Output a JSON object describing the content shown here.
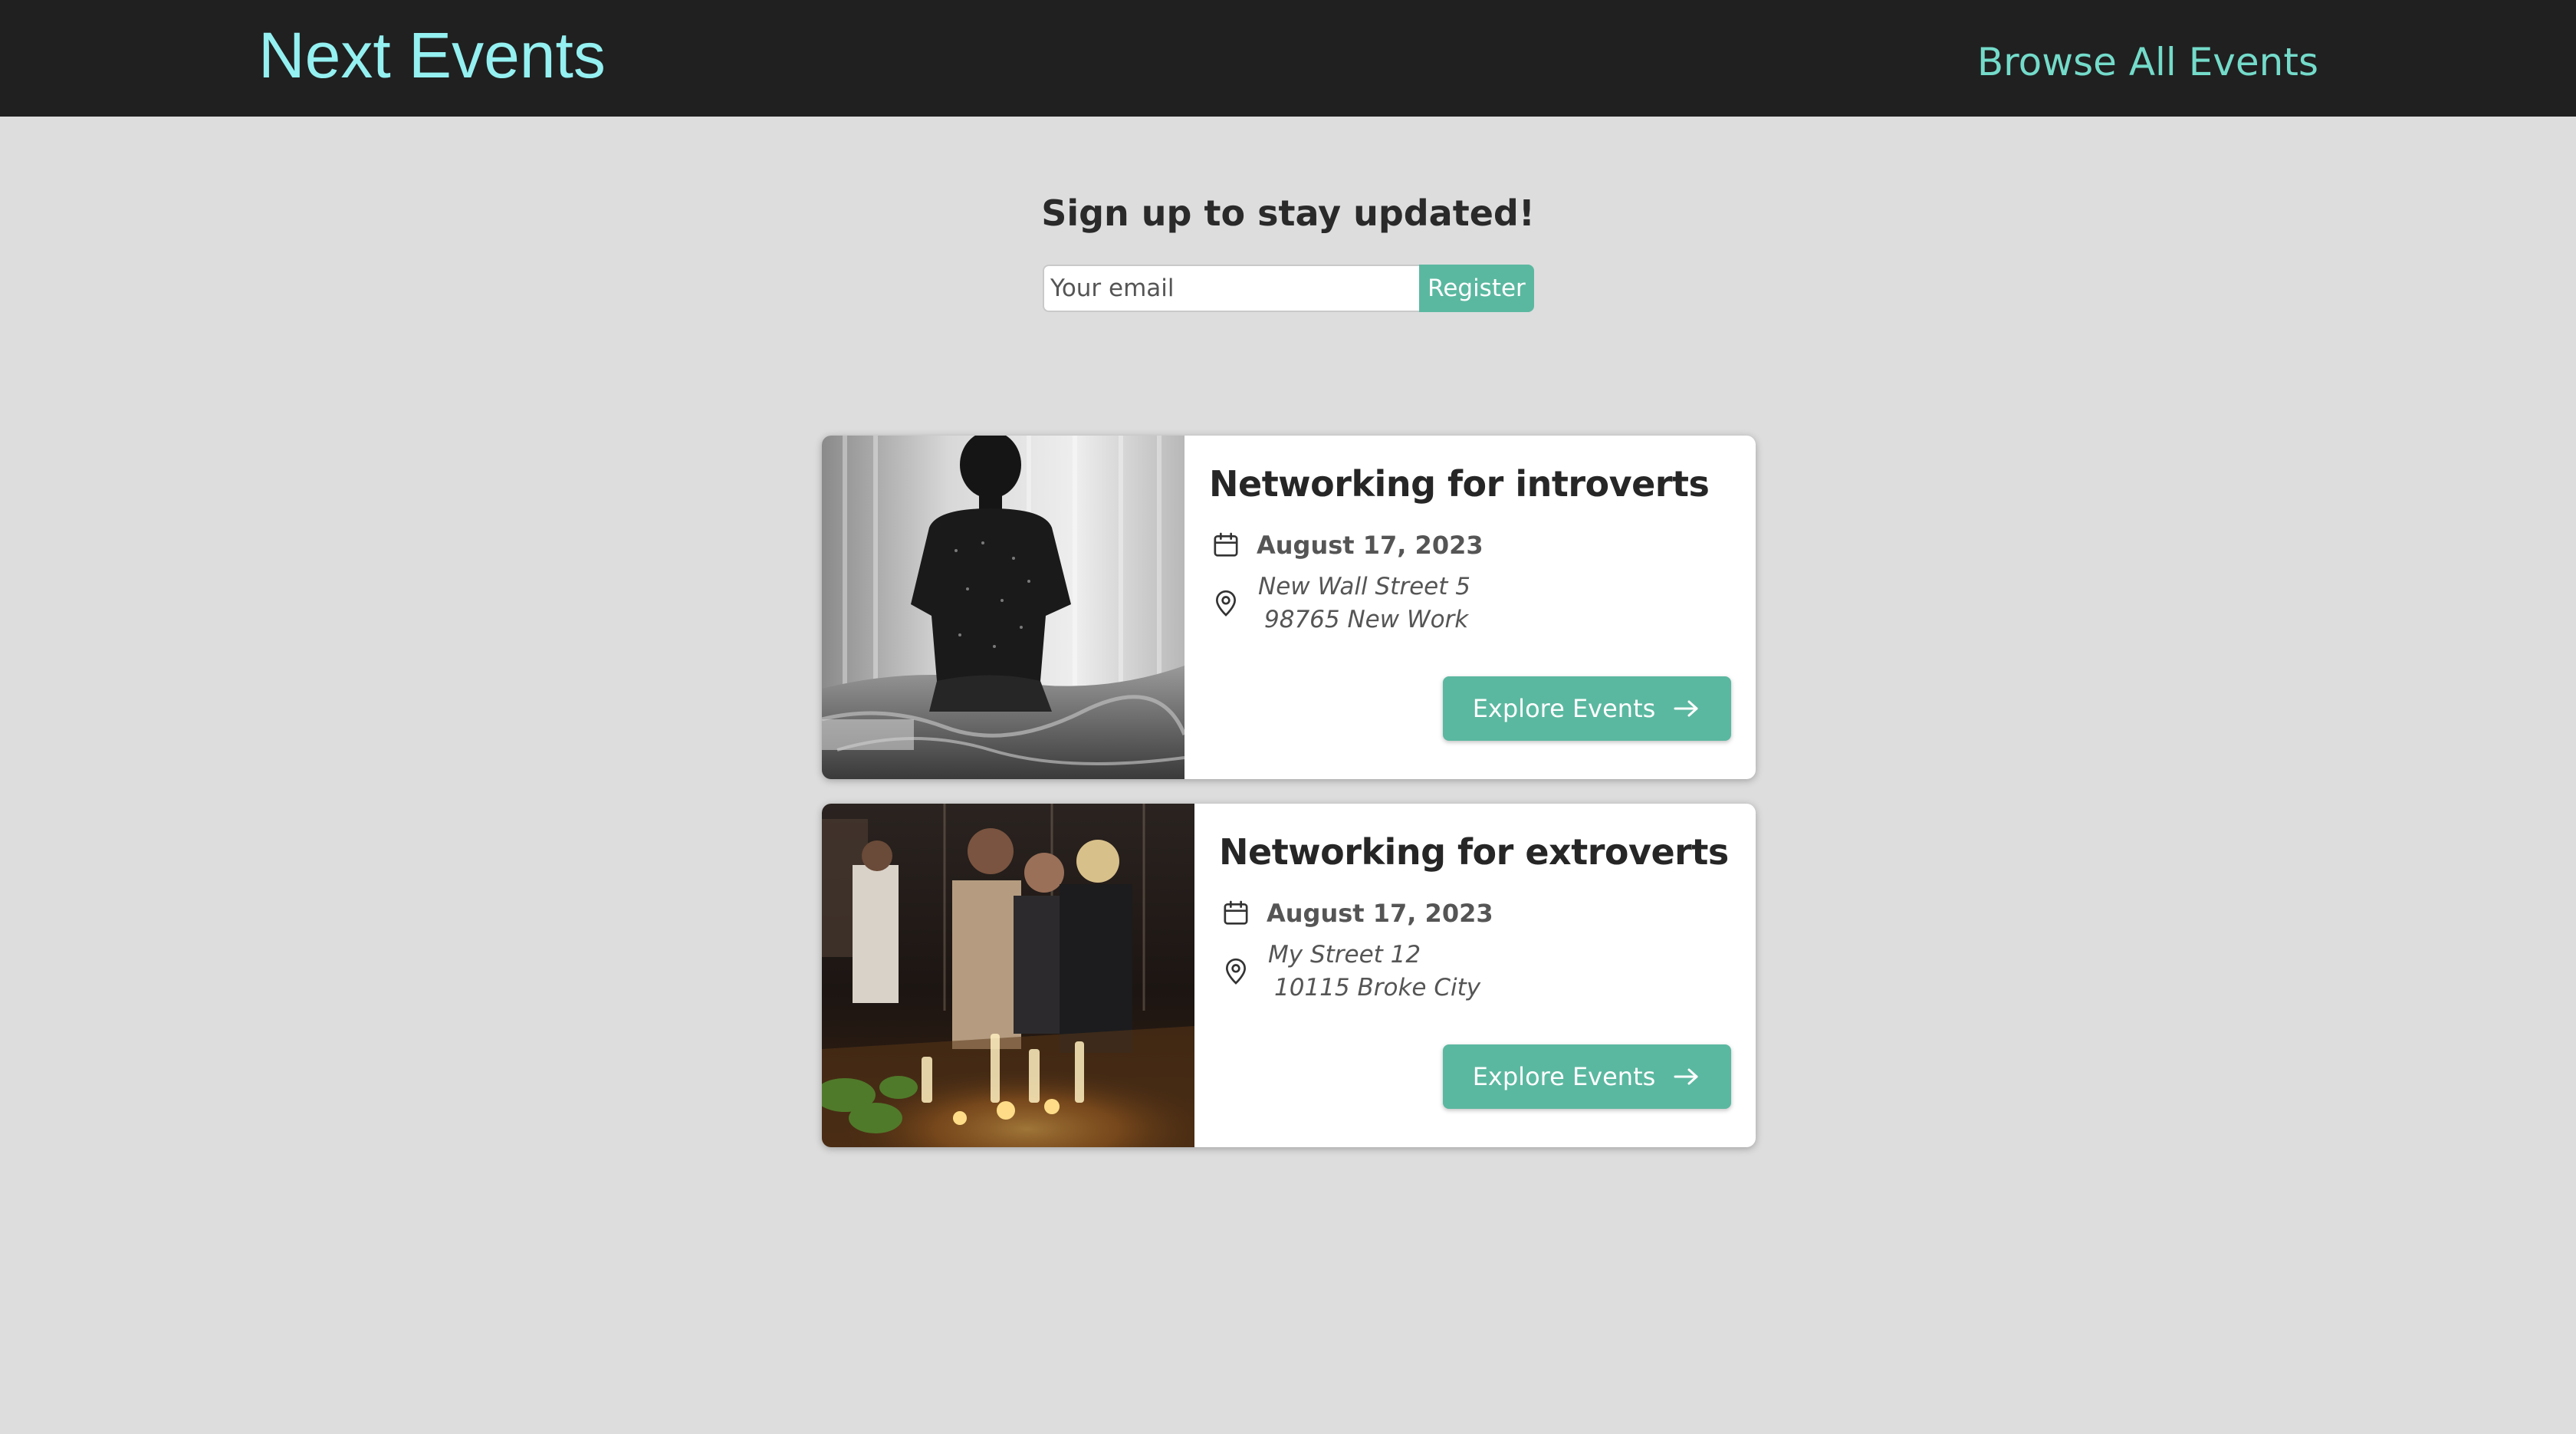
{
  "header": {
    "logo": "Next Events",
    "browse_link": "Browse All Events"
  },
  "signup": {
    "title": "Sign up to stay updated!",
    "email_placeholder": "Your email",
    "register_label": "Register"
  },
  "events": [
    {
      "title": "Networking for introverts",
      "date": "August 17, 2023",
      "address_line1": "New Wall Street 5",
      "address_line2": "98765 New Work",
      "button_label": "Explore Events",
      "image": "man-sitting-on-bed-photo"
    },
    {
      "title": "Networking for extroverts",
      "date": "August 17, 2023",
      "address_line1": "My Street 12",
      "address_line2": "10115 Broke City",
      "button_label": "Explore Events",
      "image": "people-at-bar-photo"
    }
  ],
  "colors": {
    "header_bg": "#202020",
    "logo": "#94f0f1",
    "link": "#74dbca",
    "accent": "#5bb8a0",
    "page_bg": "#dddddd"
  },
  "icons": {
    "date": "calendar-icon",
    "address": "map-pin-icon",
    "button": "arrow-right-icon"
  }
}
